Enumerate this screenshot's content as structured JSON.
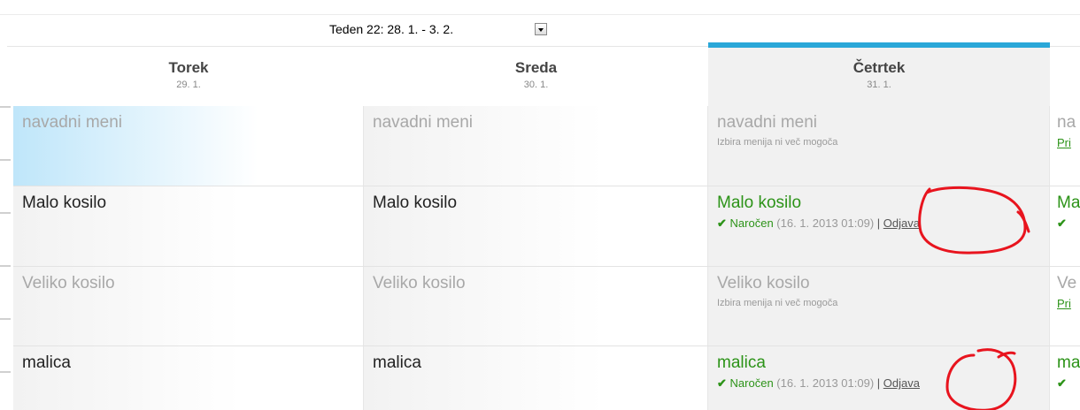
{
  "week_selector": {
    "label": "Teden 22: 28. 1. - 3. 2."
  },
  "days": [
    {
      "name": "Torek",
      "date": "29. 1."
    },
    {
      "name": "Sreda",
      "date": "30. 1."
    },
    {
      "name": "Četrtek",
      "date": "31. 1."
    }
  ],
  "meals": [
    "navadni meni",
    "Malo kosilo",
    "Veliko kosilo",
    "malica"
  ],
  "cutoff_note": "Izbira menija ni več mogoča",
  "ordered_status": {
    "label": "Naročen",
    "timestamp": "(16. 1. 2013 01:09)",
    "separator": "|",
    "unsubscribe": "Odjava"
  },
  "next_day_partial": {
    "meals": [
      "na",
      "Ma",
      "Ve",
      "ma"
    ],
    "link": "Pri"
  },
  "colors": {
    "active_day_accent": "#2aa7d8",
    "ordered_green": "#2c9318",
    "annotation_red": "#e8141e"
  }
}
